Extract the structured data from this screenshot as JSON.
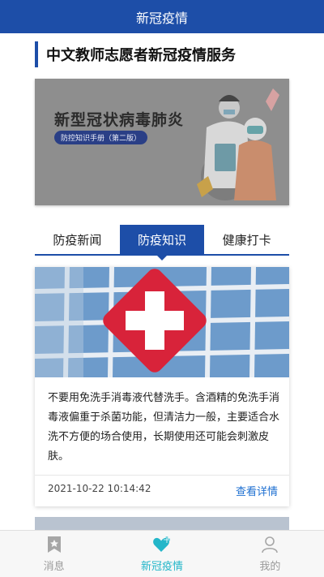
{
  "header": {
    "title": "新冠疫情"
  },
  "section": {
    "title": "中文教师志愿者新冠疫情服务"
  },
  "banner": {
    "title": "新型冠状病毒肺炎",
    "subtitle": "防控知识手册（第二版）"
  },
  "tabs": [
    {
      "label": "防疫新闻",
      "active": false
    },
    {
      "label": "防疫知识",
      "active": true
    },
    {
      "label": "健康打卡",
      "active": false
    }
  ],
  "card": {
    "text": "不要用免洗手消毒液代替洗手。含酒精的免洗手消毒液偏重于杀菌功能，但清洁力一般，主要适合水洗不方便的场合使用，长期使用还可能会刺激皮肤。",
    "time": "2021-10-22 10:14:42",
    "link": "查看详情"
  },
  "bottom_nav": [
    {
      "label": "消息",
      "icon": "star-bookmark-icon",
      "active": false
    },
    {
      "label": "新冠疫情",
      "icon": "heart-plus-icon",
      "active": true
    },
    {
      "label": "我的",
      "icon": "user-icon",
      "active": false
    }
  ],
  "colors": {
    "primary": "#1d4ea8",
    "nav_active": "#23b6c9",
    "link": "#1d6fd1"
  }
}
